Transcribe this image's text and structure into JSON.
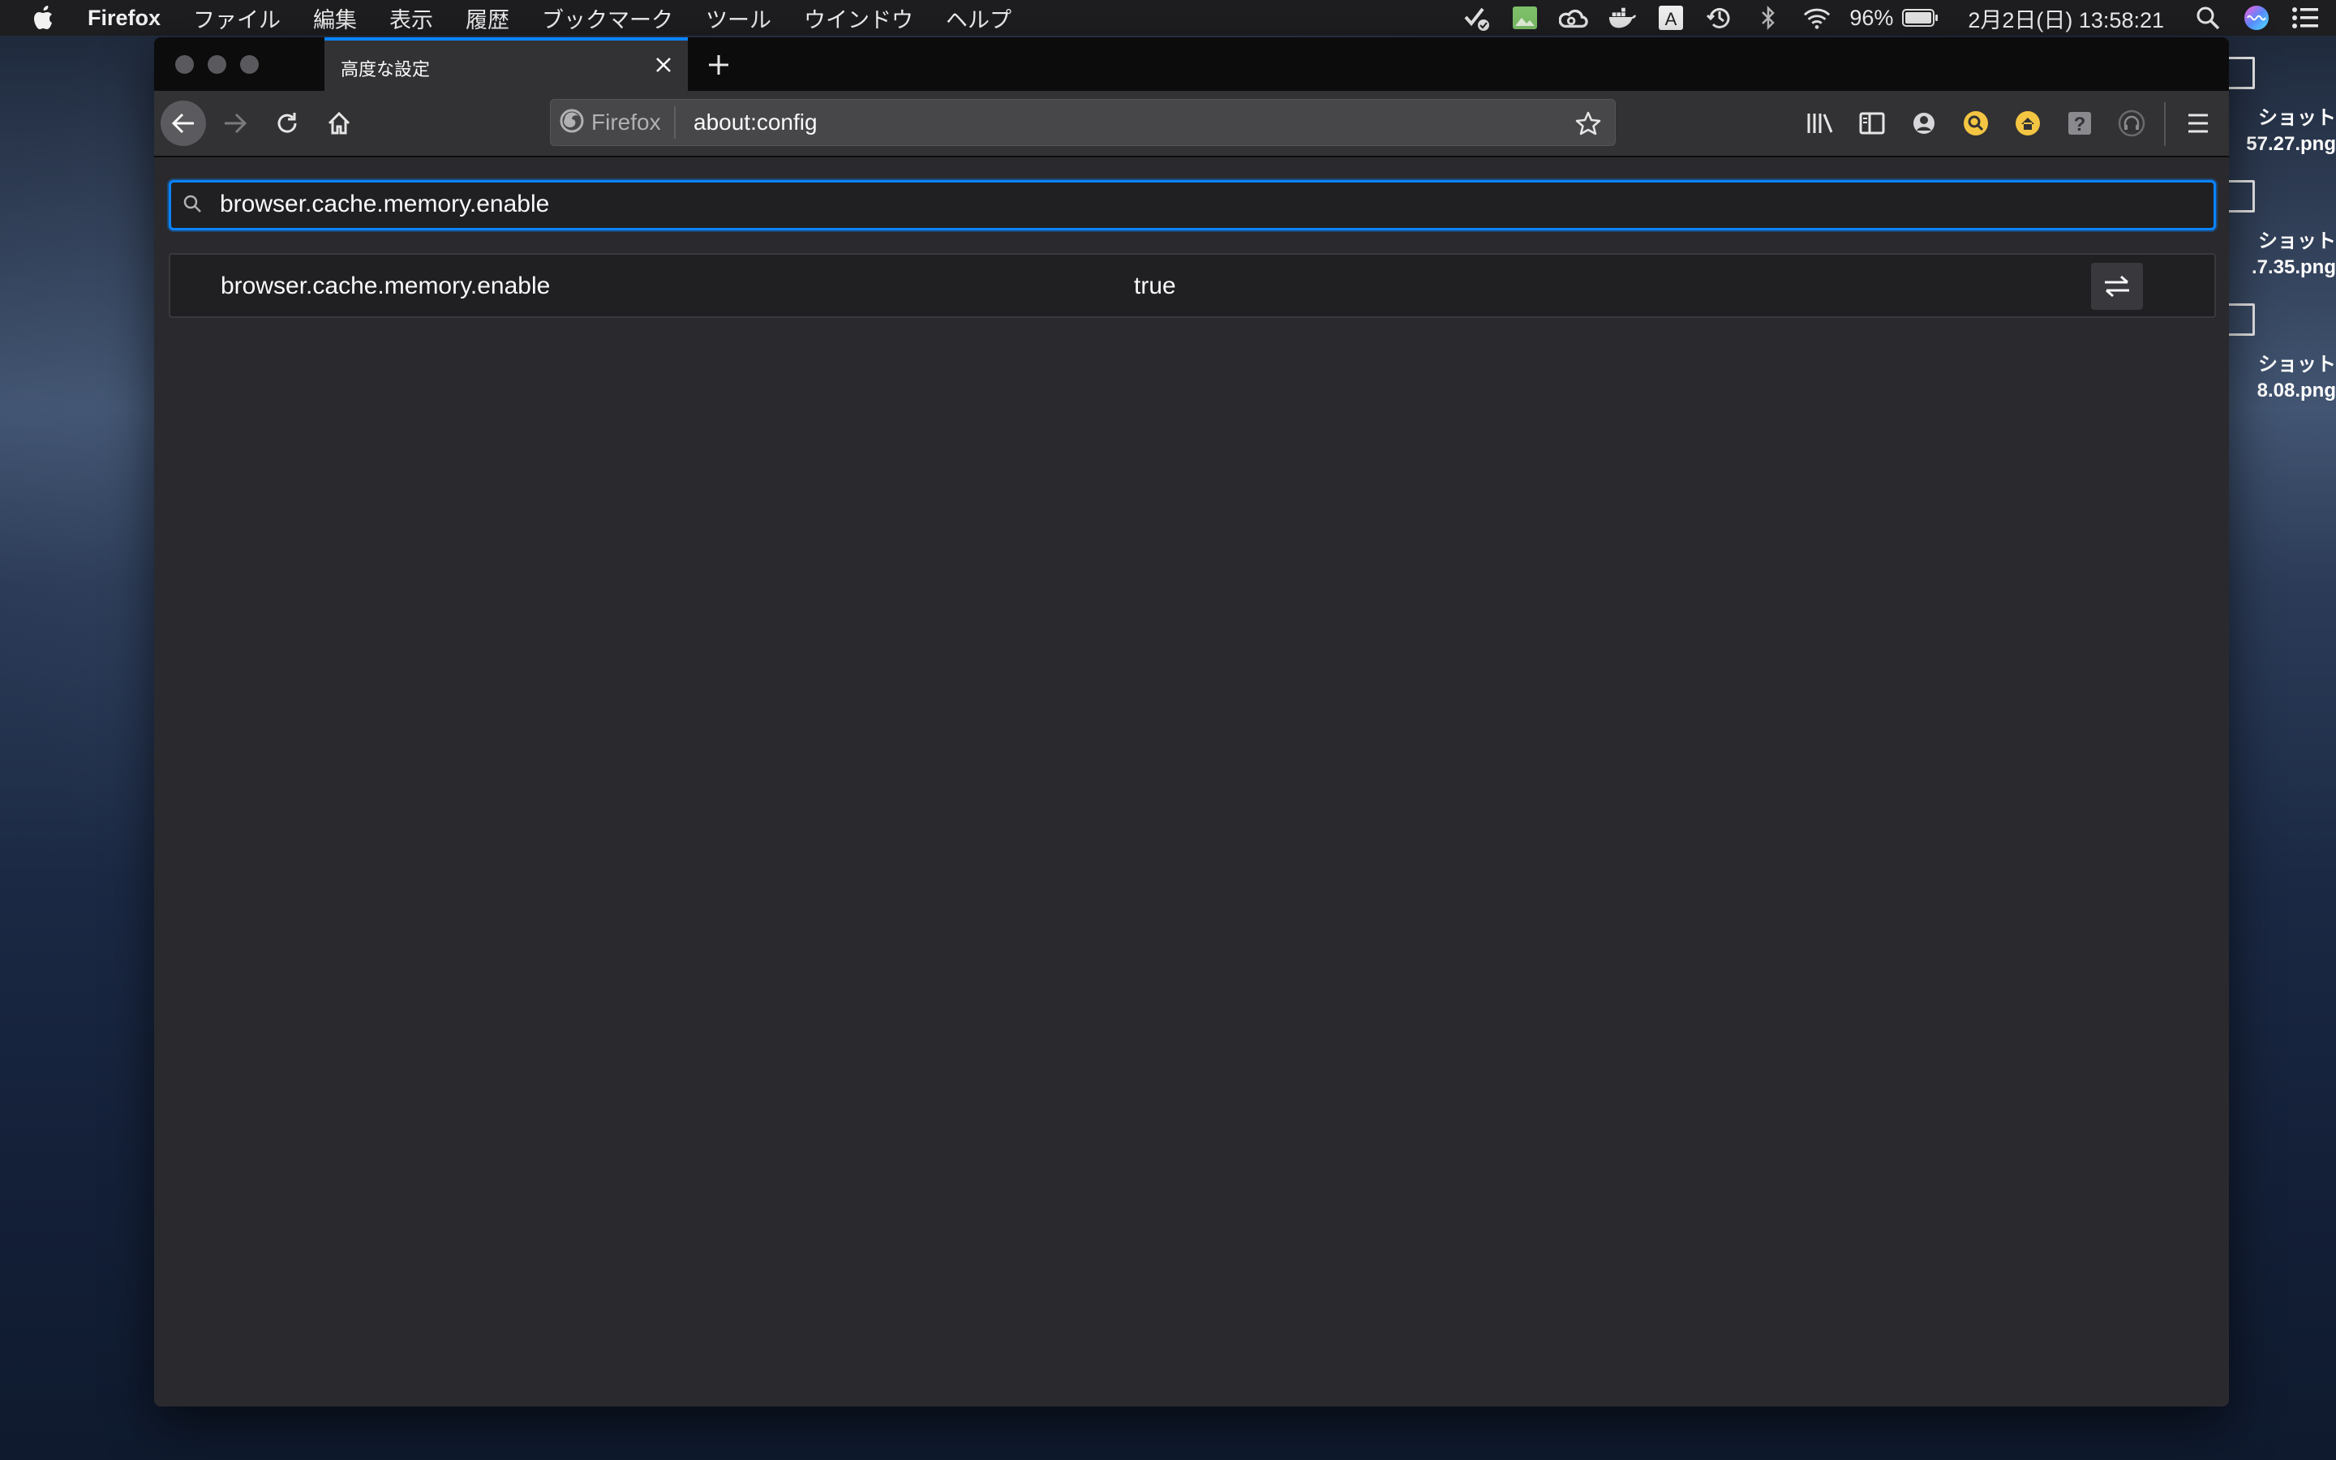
{
  "menubar": {
    "app_name": "Firefox",
    "items": [
      "ファイル",
      "編集",
      "表示",
      "履歴",
      "ブックマーク",
      "ツール",
      "ウインドウ",
      "ヘルプ"
    ],
    "status_icons": [
      "checkmark-badge-icon",
      "image-app-icon",
      "creative-cloud-icon",
      "docker-icon",
      "input-method-icon",
      "time-machine-icon",
      "bluetooth-icon",
      "wifi-icon"
    ],
    "battery": "96%",
    "date_time": "2月2日(日)  13:58:21"
  },
  "desktop": {
    "files": [
      {
        "label_line1": "ショット",
        "label_line2": "57.27.png"
      },
      {
        "label_line1": "ショット",
        "label_line2": ".7.35.png"
      },
      {
        "label_line1": "ショット",
        "label_line2": "8.08.png"
      }
    ]
  },
  "browser": {
    "tab": {
      "title": "高度な設定"
    },
    "identity_label": "Firefox",
    "url": "about:config",
    "toolbar_icons": [
      "library-icon",
      "sidebar-icon",
      "account-icon",
      "extension-search-icon",
      "extension-home-icon",
      "help-icon",
      "extension-headphones-icon",
      "menu-icon"
    ]
  },
  "config": {
    "search_value": "browser.cache.memory.enable",
    "preferences": [
      {
        "name": "browser.cache.memory.enable",
        "value": "true"
      }
    ]
  },
  "colors": {
    "accent": "#0a84ff",
    "tab_background": "#323234",
    "content_background": "#2a2a2e",
    "row_background": "#202023"
  }
}
